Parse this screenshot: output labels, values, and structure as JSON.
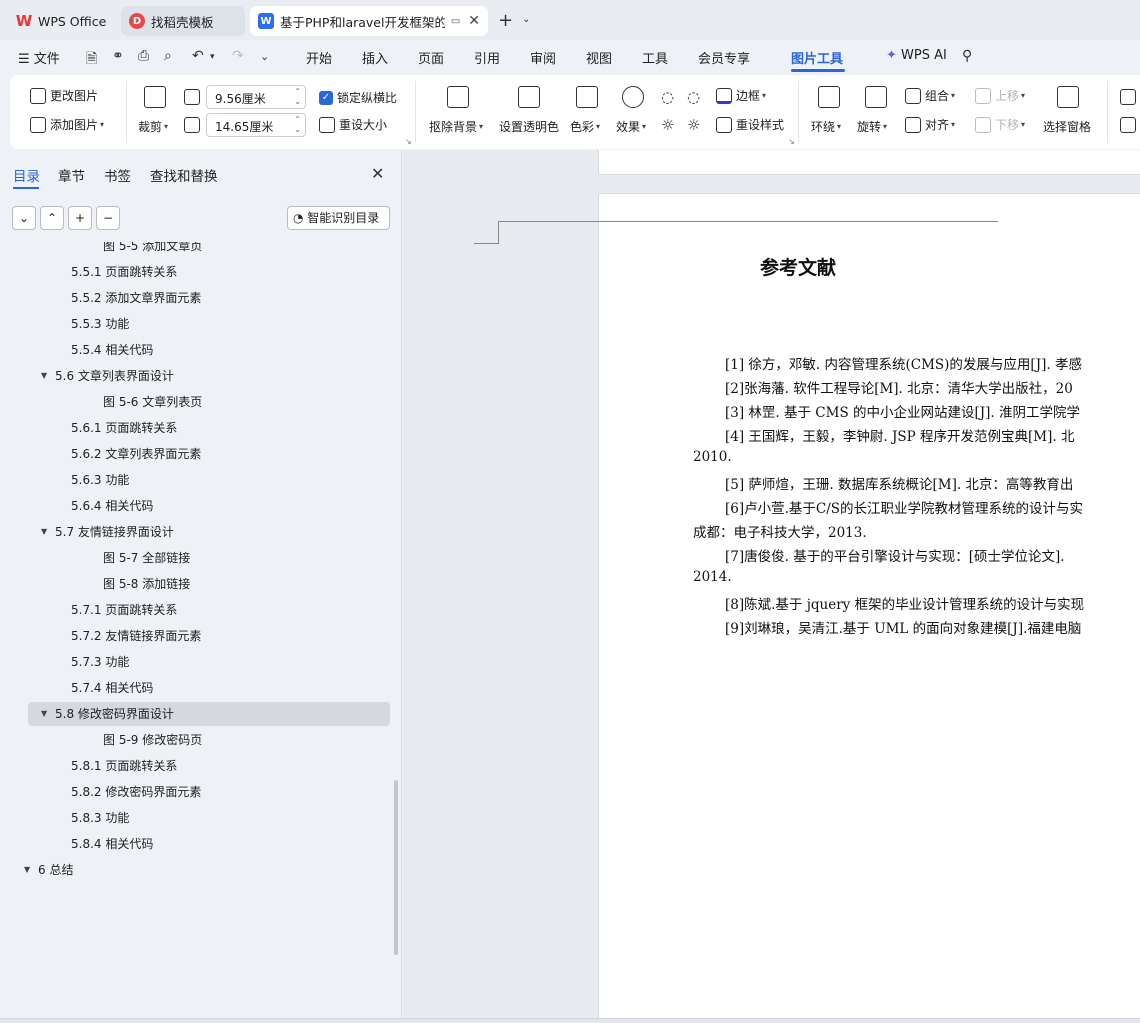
{
  "tabs": [
    {
      "label": "WPS Office"
    },
    {
      "label": "找稻壳模板"
    },
    {
      "label": "基于PHP和laravel开发框架的C"
    }
  ],
  "menu": {
    "file": "文件",
    "items": [
      "开始",
      "插入",
      "页面",
      "引用",
      "审阅",
      "视图",
      "工具",
      "会员专享",
      "图片工具"
    ],
    "ai": "WPS AI",
    "active": "图片工具"
  },
  "ribbon": {
    "change_image": "更改图片",
    "add_image": "添加图片",
    "crop": "裁剪",
    "width_value": "9.56厘米",
    "height_value": "14.65厘米",
    "lock_ratio": "锁定纵横比",
    "reset_size": "重设大小",
    "remove_bg": "抠除背景",
    "set_transparent": "设置透明色",
    "color": "色彩",
    "effect": "效果",
    "border": "边框",
    "reset_style": "重设样式",
    "wrap": "环绕",
    "rotate": "旋转",
    "group": "组合",
    "align": "对齐",
    "move_up": "上移",
    "move_down": "下移",
    "selection_pane": "选择窗格"
  },
  "sidebar": {
    "tabs": [
      "目录",
      "章节",
      "书签",
      "查找和替换"
    ],
    "smart_toc": "智能识别目录",
    "toc": [
      {
        "label": "图 5-5  添加文章页",
        "indent": 3
      },
      {
        "label": "5.5.1 页面跳转关系",
        "indent": 2
      },
      {
        "label": "5.5.2 添加文章界面元素",
        "indent": 2
      },
      {
        "label": "5.5.3 功能",
        "indent": 2
      },
      {
        "label": "5.5.4 相关代码",
        "indent": 2
      },
      {
        "label": "5.6 文章列表界面设计",
        "indent": 1,
        "expanded": true
      },
      {
        "label": "图 5-6  文章列表页",
        "indent": 3
      },
      {
        "label": "5.6.1 页面跳转关系",
        "indent": 2
      },
      {
        "label": "5.6.2 文章列表界面元素",
        "indent": 2
      },
      {
        "label": "5.6.3 功能",
        "indent": 2
      },
      {
        "label": "5.6.4 相关代码",
        "indent": 2
      },
      {
        "label": "5.7 友情链接界面设计",
        "indent": 1,
        "expanded": true
      },
      {
        "label": "图 5-7  全部链接",
        "indent": 3
      },
      {
        "label": "图 5-8  添加链接",
        "indent": 3
      },
      {
        "label": "5.7.1 页面跳转关系",
        "indent": 2
      },
      {
        "label": "5.7.2 友情链接界面元素",
        "indent": 2
      },
      {
        "label": "5.7.3 功能",
        "indent": 2
      },
      {
        "label": "5.7.4 相关代码",
        "indent": 2
      },
      {
        "label": "5.8 修改密码界面设计",
        "indent": 1,
        "expanded": true,
        "selected": true
      },
      {
        "label": "图 5-9  修改密码页",
        "indent": 3
      },
      {
        "label": "5.8.1 页面跳转关系",
        "indent": 2
      },
      {
        "label": "5.8.2 修改密码界面元素",
        "indent": 2
      },
      {
        "label": "5.8.3 功能",
        "indent": 2
      },
      {
        "label": "5.8.4 相关代码",
        "indent": 2
      },
      {
        "label": "6 总结",
        "indent": 0,
        "expanded": true
      }
    ]
  },
  "document": {
    "heading": "参考文献",
    "references": [
      "[1] 徐方，邓敏. 内容管理系统(CMS)的发展与应用[J]. 孝感",
      "[2]张海藩. 软件工程导论[M]. 北京：清华大学出版社，20",
      "[3] 林罡. 基于 CMS 的中小企业网站建设[J]. 淮阴工学院学",
      "[4] 王国辉，王毅，李钟尉. JSP 程序开发范例宝典[M]. 北",
      "2010.",
      "[5] 萨师煊，王珊. 数据库系统概论[M]. 北京：高等教育出",
      "[6]卢小萱.基于C/S的长江职业学院教材管理系统的设计与实",
      "成都：电子科技大学，2013.",
      "[7]唐俊俊. 基于的平台引擎设计与实现：[硕士学位论文].",
      "2014.",
      "[8]陈斌.基于 jquery 框架的毕业设计管理系统的设计与实现",
      "[9]刘琳琅，吴清江.基于 UML 的面向对象建模[J].福建电脑"
    ]
  }
}
